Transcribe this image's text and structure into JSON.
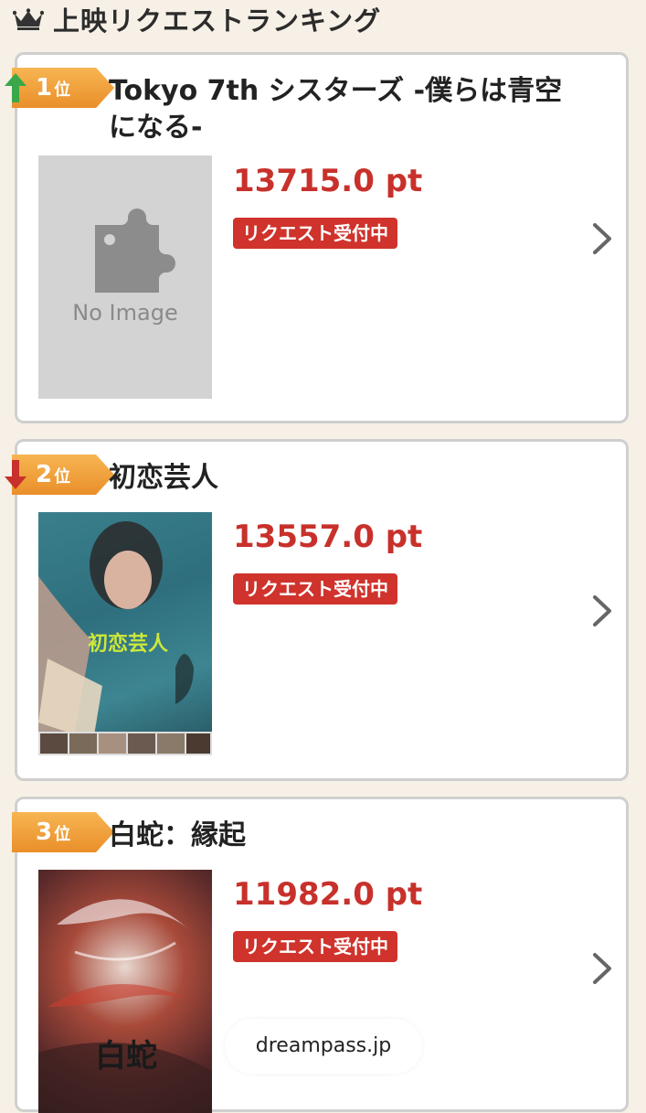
{
  "header": {
    "title": "上映リクエストランキング",
    "icon": "crown-icon"
  },
  "colors": {
    "points": "#c8312b",
    "status_bg": "#cf332c",
    "rank_badge": "#f0a039",
    "trend_up": "#3aa84a",
    "trend_down": "#c8312b"
  },
  "items": [
    {
      "rank": "1",
      "rank_suffix": "位",
      "trend": "up",
      "title": "Tokyo 7th シスターズ -僕らは青空になる-",
      "points": "13715.0 pt",
      "status": "リクエスト受付中",
      "poster": {
        "type": "no-image",
        "label": "No Image"
      }
    },
    {
      "rank": "2",
      "rank_suffix": "位",
      "trend": "down",
      "title": "初恋芸人",
      "points": "13557.0 pt",
      "status": "リクエスト受付中",
      "poster": {
        "type": "image",
        "title_art": "初恋芸人"
      }
    },
    {
      "rank": "3",
      "rank_suffix": "位",
      "trend": "none",
      "title": "白蛇：縁起",
      "points": "11982.0 pt",
      "status": "リクエスト受付中",
      "poster": {
        "type": "image",
        "title_art": "白蛇"
      }
    }
  ],
  "watermark": "dreampass.jp"
}
